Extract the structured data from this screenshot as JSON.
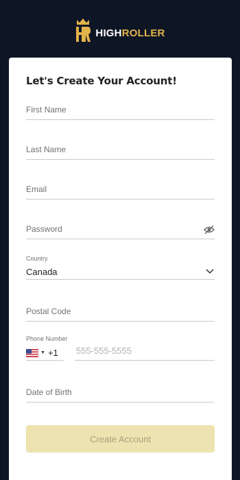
{
  "brand": {
    "logo_mark": "HR",
    "name_part1": "HIGH",
    "name_part2": "ROLLER",
    "accent_color": "#e2b24a"
  },
  "form": {
    "title": "Let's Create Your Account!",
    "first_name": {
      "placeholder": "First Name"
    },
    "last_name": {
      "placeholder": "Last Name"
    },
    "email": {
      "placeholder": "Email"
    },
    "password": {
      "placeholder": "Password",
      "icon": "eye-off-icon"
    },
    "country": {
      "label": "Country",
      "value": "Canada",
      "icon": "chevron-down-icon"
    },
    "postal_code": {
      "placeholder": "Postal Code"
    },
    "phone": {
      "label": "Phone Number",
      "flag": "us-flag-icon",
      "code": "+1",
      "placeholder": "555-555-5555"
    },
    "dob": {
      "placeholder": "Date of Birth"
    },
    "submit_label": "Create Account",
    "submit_color": "#ede3b0"
  }
}
